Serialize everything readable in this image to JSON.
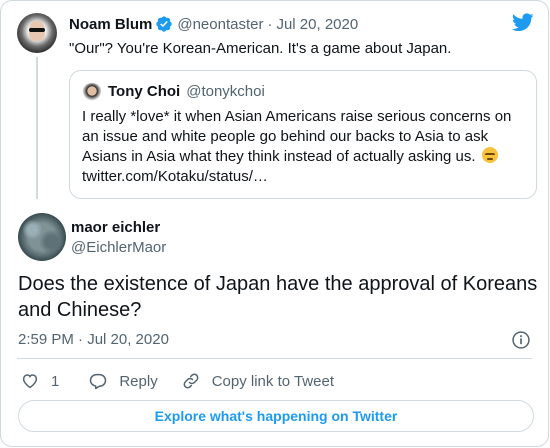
{
  "colors": {
    "accent": "#1d9bf0",
    "text_primary": "#0f1419",
    "text_secondary": "#536471",
    "border": "#cfd9de"
  },
  "parent_tweet": {
    "author_name": "Noam Blum",
    "handle": "@neontaster",
    "separator": "·",
    "date": "Jul 20, 2020",
    "text": "\"Our\"? You're Korean-American. It's a game about Japan.",
    "icons": [
      "avatar",
      "verified-badge-icon",
      "twitter-logo-icon"
    ]
  },
  "quoted_tweet": {
    "author_name": "Tony Choi",
    "handle": "@tonykchoi",
    "text": "I really *love* it when Asian Americans raise serious concerns on an issue and white people go behind our backs to Asia to ask Asians in Asia what they think instead of actually asking us.",
    "emoji": "unamused-face-emoji",
    "link": "twitter.com/Kotaku/status/…"
  },
  "main_tweet": {
    "author_name": "maor eichler",
    "handle": "@EichlerMaor",
    "text": "Does the existence of Japan have the approval of Koreans and Chinese?",
    "timestamp": "2:59 PM · Jul 20, 2020"
  },
  "actions": {
    "like_count": "1",
    "reply_label": "Reply",
    "copy_link_label": "Copy link to Tweet",
    "icons": [
      "heart-icon",
      "reply-icon",
      "link-icon",
      "info-icon"
    ]
  },
  "explore_button": "Explore what's happening on Twitter"
}
